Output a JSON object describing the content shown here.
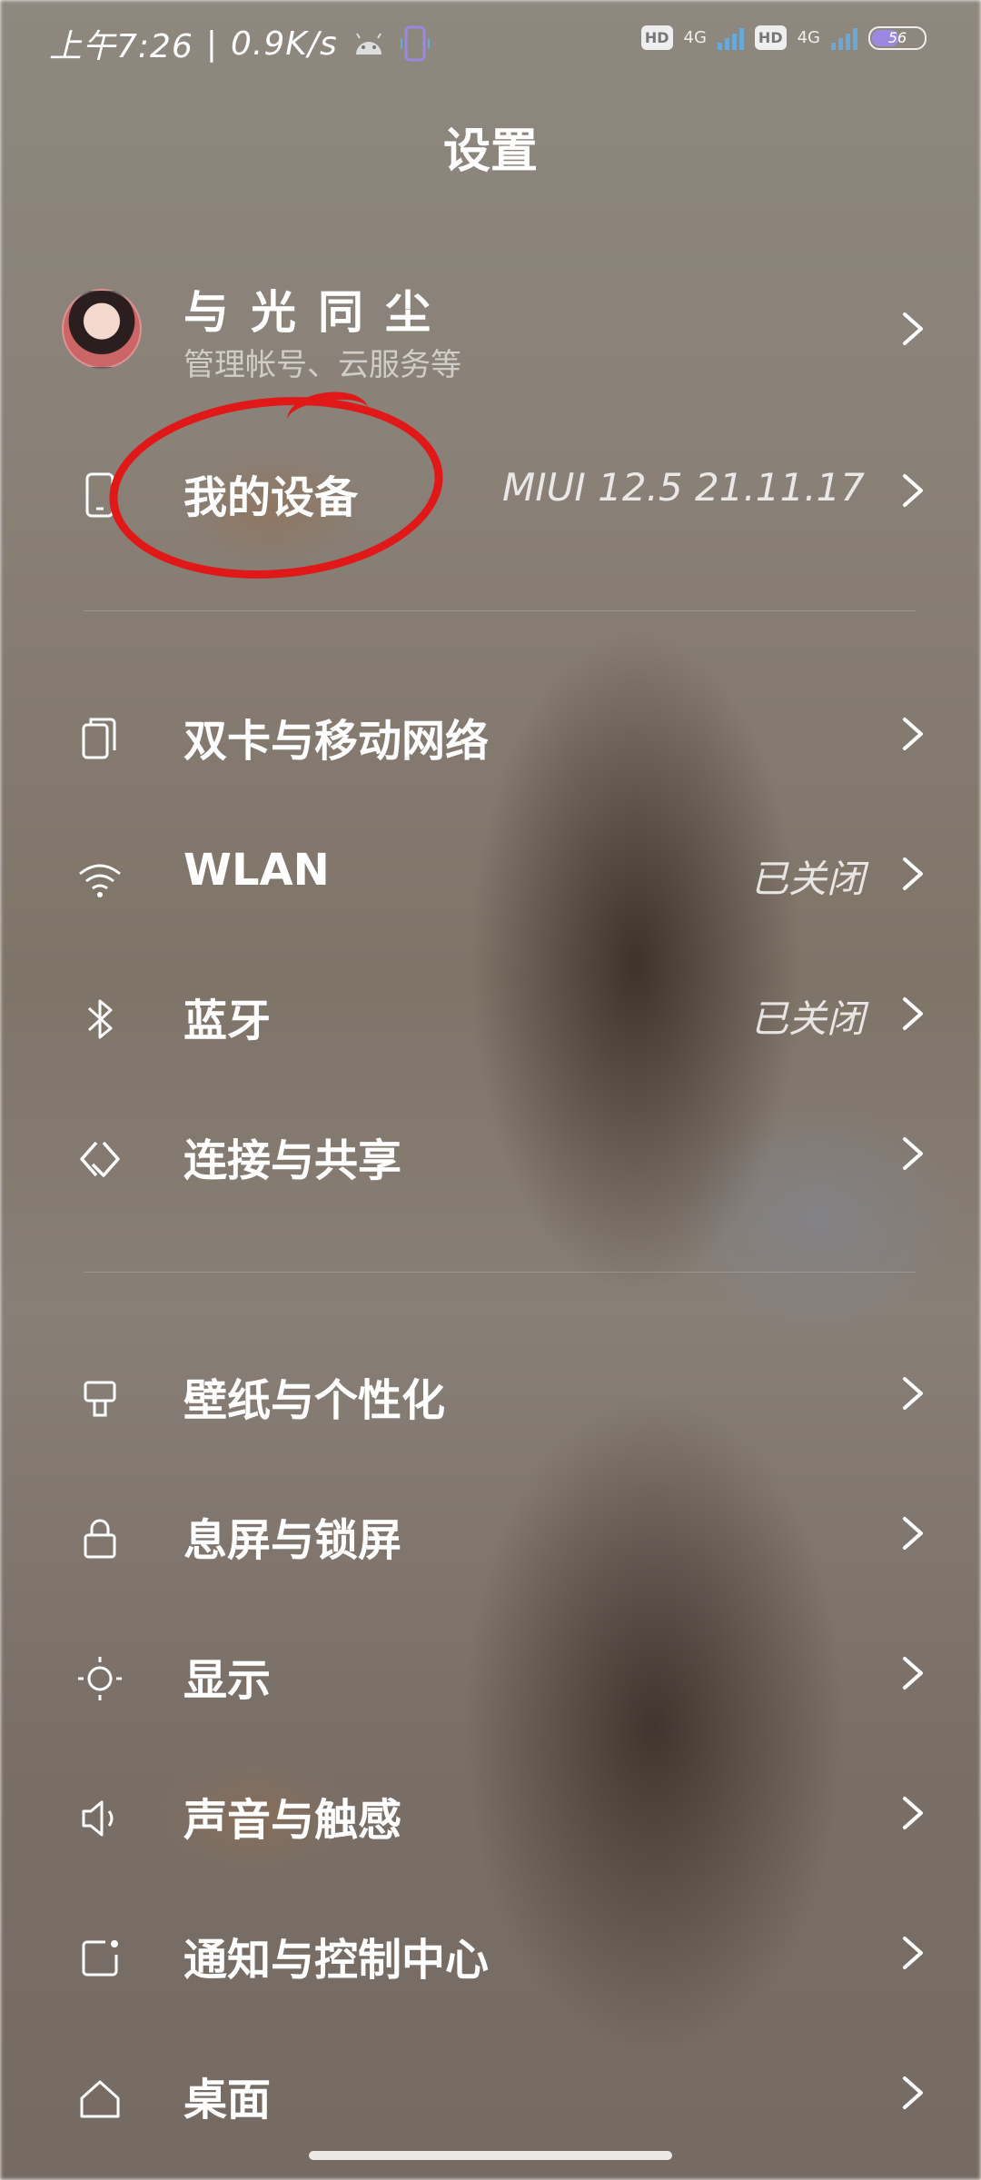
{
  "status_bar": {
    "time": "上午7:26",
    "speed": "0.9K/s",
    "sim1_hd": "HD",
    "sim1_net": "4G",
    "sim2_hd": "HD",
    "sim2_net": "4G",
    "battery": "56",
    "battery_level": 0.56,
    "accent_color": "#9c88e0"
  },
  "header": {
    "title": "设置"
  },
  "profile": {
    "name": "与光同尘",
    "subtitle": "管理帐号、云服务等"
  },
  "device": {
    "label": "我的设备",
    "value": "MIUI 12.5 21.11.17"
  },
  "network": [
    {
      "icon": "dual-sim-icon",
      "label": "双卡与移动网络",
      "value": ""
    },
    {
      "icon": "wifi-icon",
      "label": "WLAN",
      "value": "已关闭"
    },
    {
      "icon": "bluetooth-icon",
      "label": "蓝牙",
      "value": "已关闭"
    },
    {
      "icon": "connection-share-icon",
      "label": "连接与共享",
      "value": ""
    }
  ],
  "personal": [
    {
      "icon": "wallpaper-icon",
      "label": "壁纸与个性化"
    },
    {
      "icon": "lock-icon",
      "label": "息屏与锁屏"
    },
    {
      "icon": "display-icon",
      "label": "显示"
    },
    {
      "icon": "sound-icon",
      "label": "声音与触感"
    },
    {
      "icon": "notification-icon",
      "label": "通知与控制中心"
    },
    {
      "icon": "home-icon",
      "label": "桌面"
    }
  ],
  "annotation_color": "#e01818"
}
